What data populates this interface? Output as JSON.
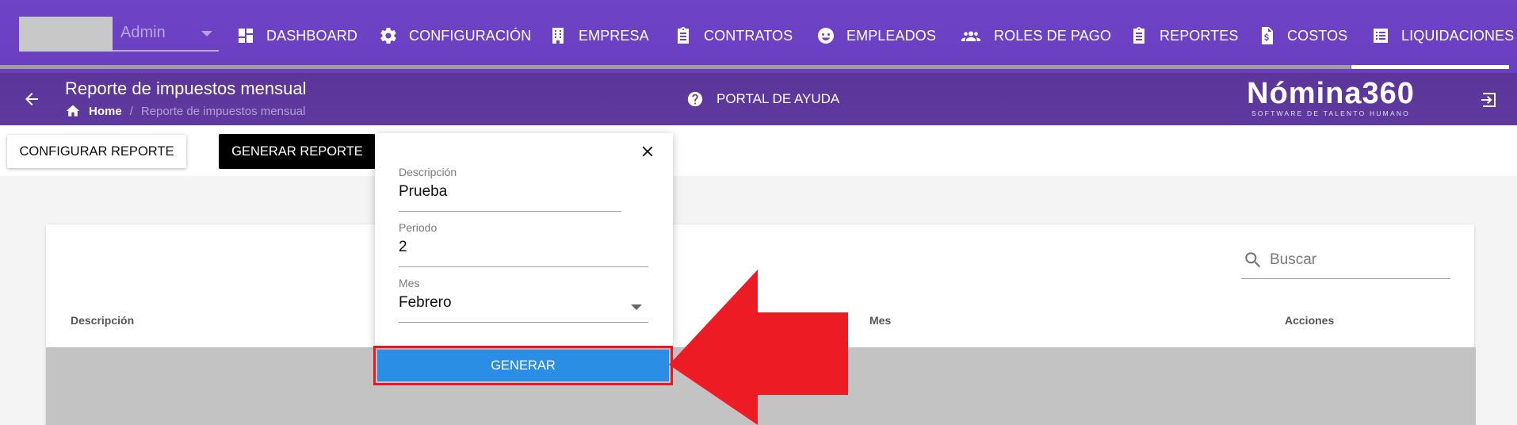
{
  "topbar": {
    "user": {
      "name": "Admin"
    },
    "nav": [
      {
        "label": "DASHBOARD",
        "icon": "dashboard-icon"
      },
      {
        "label": "CONFIGURACIÓN",
        "icon": "gear-icon"
      },
      {
        "label": "EMPRESA",
        "icon": "building-icon"
      },
      {
        "label": "CONTRATOS",
        "icon": "clipboard-icon"
      },
      {
        "label": "EMPLEADOS",
        "icon": "face-icon"
      },
      {
        "label": "ROLES DE PAGO",
        "icon": "people-icon"
      },
      {
        "label": "REPORTES",
        "icon": "clipboard-icon"
      },
      {
        "label": "COSTOS",
        "icon": "dollar-file-icon"
      },
      {
        "label": "LIQUIDACIONES",
        "icon": "list-icon"
      }
    ],
    "active_nav": "LIQUIDACIONES"
  },
  "header": {
    "title": "Reporte de impuestos mensual",
    "breadcrumb": {
      "home": "Home",
      "separator": "/",
      "current": "Reporte de impuestos mensual"
    },
    "help_label": "PORTAL DE AYUDA",
    "logo": {
      "brand": "Nómina360",
      "tagline": "SOFTWARE DE TALENTO HUMANO"
    }
  },
  "toolbar": {
    "configure_label": "CONFIGURAR REPORTE",
    "generate_report_label": "GENERAR REPORTE"
  },
  "form": {
    "descripcion": {
      "label": "Descripción",
      "value": "Prueba"
    },
    "periodo": {
      "label": "Periodo",
      "value": "2"
    },
    "mes": {
      "label": "Mes",
      "value": "Febrero"
    },
    "submit_label": "GENERAR"
  },
  "table": {
    "search_placeholder": "Buscar",
    "columns": [
      "Descripción",
      "Mes",
      "Acciones"
    ]
  },
  "colors": {
    "nav_bg": "#6a3fc0",
    "subheader_bg": "#5b3599",
    "primary_button": "#2a8de6",
    "highlight": "#e31a24"
  }
}
